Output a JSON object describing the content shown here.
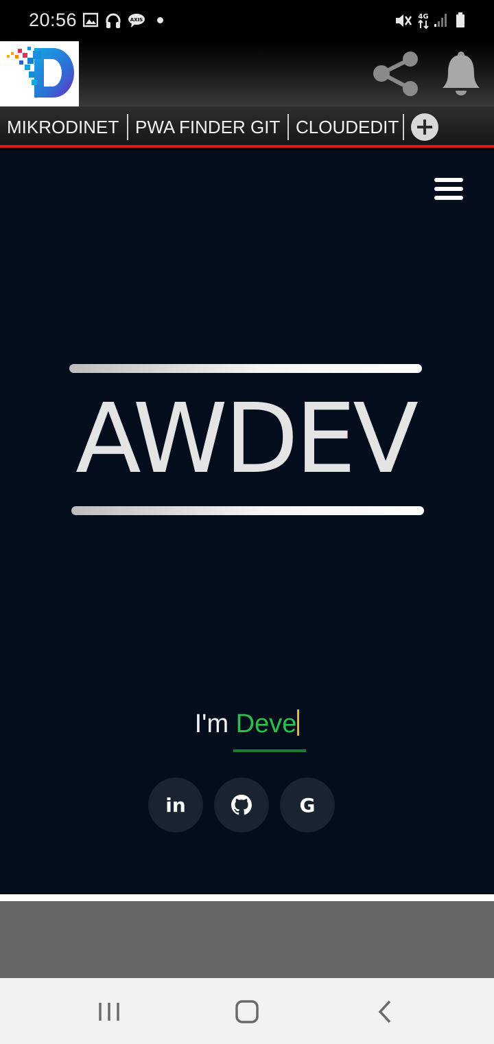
{
  "status_bar": {
    "time": "20:56",
    "icons": [
      "image-icon",
      "headphones-icon",
      "axis-icon",
      "notification-dot",
      "mute-icon",
      "4g-icon",
      "signal-icon",
      "battery-icon"
    ]
  },
  "header": {
    "logo_alt": "D logo",
    "share_icon": "share-icon",
    "bell_icon": "bell-icon"
  },
  "tabs": [
    {
      "label": "MIKRODINET"
    },
    {
      "label": "PWA FINDER GIT"
    },
    {
      "label": "CLOUDEDIT"
    }
  ],
  "hero": {
    "brand": "AWDEV",
    "tagline_prefix": "I'm",
    "tagline_word": "Deve",
    "social": [
      {
        "name": "linkedin",
        "label": "in"
      },
      {
        "name": "github",
        "label": ""
      },
      {
        "name": "google",
        "label": "G"
      }
    ]
  },
  "colors": {
    "hero_bg": "#030d1b",
    "accent_red": "#e3141b",
    "accent_green": "#27c24c",
    "caret": "#f0b429"
  }
}
